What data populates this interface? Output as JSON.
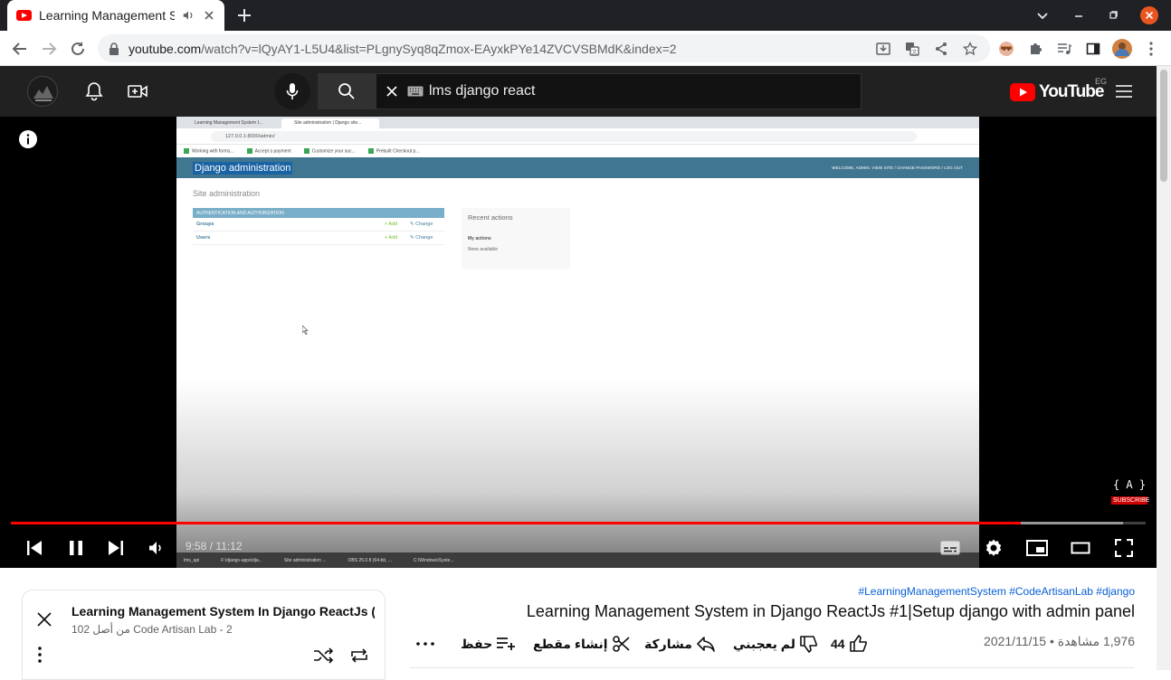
{
  "browser": {
    "tab_title": "Learning Management System In Django ReactJs",
    "url_host": "youtube.com",
    "url_path": "/watch?v=lQyAY1-L5U4&list=PLgnySyq8qZmox-EAyxkPYe14ZVCVSBMdK&index=2"
  },
  "youtube": {
    "search_value": "lms django react",
    "logo_text": "YouTube",
    "country_code": "EG"
  },
  "player": {
    "current_time": "9:58",
    "duration": "11:12",
    "time_display": "9:58 / 11:12",
    "played_fraction": 0.89,
    "buffered_fraction": 0.98,
    "watermark_symbol": "{ A }",
    "watermark_label": "SUBSCRIBE"
  },
  "frame": {
    "tab1": "Learning Management System I...",
    "tab2": "Site administration | Django site...",
    "address": "127.0.0.1:8000/admin/",
    "bookmarks": [
      "Working with forms...",
      "Accept a payment",
      "Customize your suc...",
      "Prebuilt Checkout p..."
    ],
    "header_title": "Django administration",
    "header_user": "WELCOME, ADMIN. VIEW SITE / CHANGE PASSWORD / LOG OUT",
    "site_title": "Site administration",
    "module_caption": "AUTHENTICATION AND AUTHORIZATION",
    "rows": [
      {
        "name": "Groups",
        "add": "+ Add",
        "change": "✎ Change"
      },
      {
        "name": "Users",
        "add": "+ Add",
        "change": "✎ Change"
      }
    ],
    "recent_title": "Recent actions",
    "my_actions": "My actions",
    "none_available": "None available",
    "taskbar": [
      "lms_api",
      "F:\\django-apps\\dja...",
      "Site administration ...",
      "OBS 25.0.8 (64-bit, ...",
      "C:\\Windows\\Syste..."
    ]
  },
  "playlist": {
    "title": "Learning Management System In Django ReactJs (...",
    "subtitle": "Code Artisan Lab - 2 من أصل 102"
  },
  "video": {
    "hashtags": "#LearningManagementSystem #CodeArtisanLab #django",
    "title": "Learning Management System in Django ReactJs #1|Setup django with admin panel",
    "meta": "1,976 مشاهدة • 2021/11/15",
    "likes": "44",
    "dislike_label": "لم يعجبني",
    "share_label": "مشاركة",
    "clip_label": "إنشاء مقطع",
    "save_label": "حفظ"
  }
}
